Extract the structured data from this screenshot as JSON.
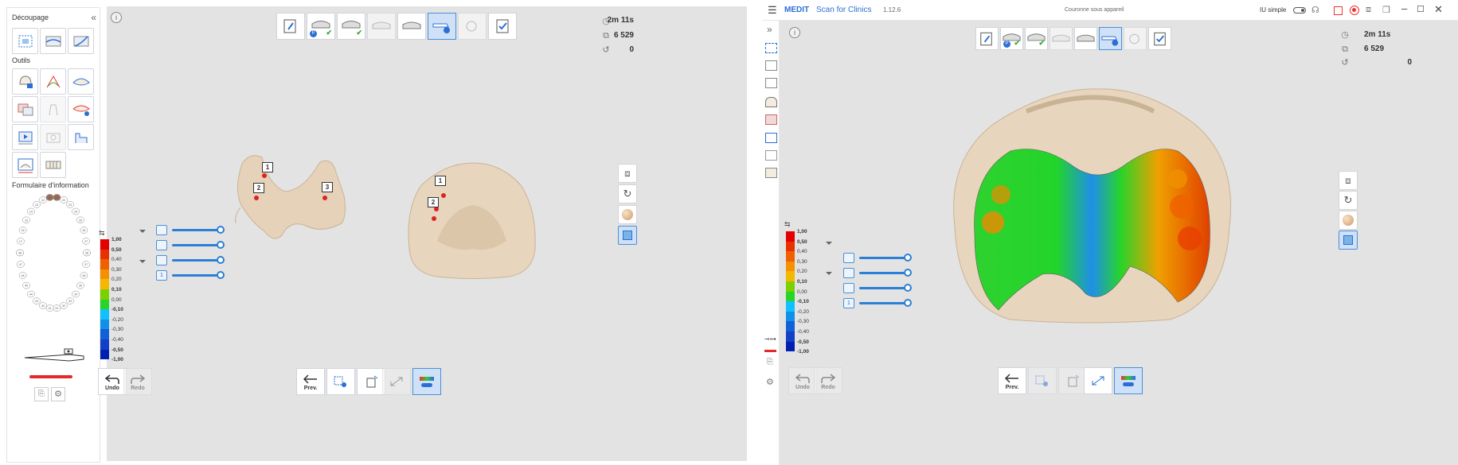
{
  "colors": {
    "accent": "#2b7fd6",
    "selected_bg": "#cfe1f7",
    "model": "#e8d5bd",
    "viewport_bg": "#e3e3e3"
  },
  "left_window": {
    "sidebar": {
      "section_cut": "Découpage",
      "section_tools": "Outils",
      "section_form": "Formulaire d'information",
      "cut_tools": [
        "crop-region-icon",
        "trim-surface-icon",
        "cut-curve-icon"
      ],
      "tools": [
        "lock-tooth-icon",
        "smooth-brush-icon",
        "arch-fill-icon",
        "compare-icon",
        "tooth-outline-icon",
        "align-arch-icon",
        "play-video-icon",
        "capture-icon",
        "profile-icon",
        "measure-icon",
        "tooth-library-icon"
      ],
      "tooth_numbers": [
        "11",
        "12",
        "13",
        "14",
        "15",
        "16",
        "17",
        "18",
        "21",
        "22",
        "23",
        "24",
        "25",
        "26",
        "27",
        "28",
        "31",
        "32",
        "33",
        "34",
        "35",
        "36",
        "37",
        "38",
        "41",
        "42",
        "43",
        "44",
        "45",
        "46",
        "47",
        "48"
      ]
    },
    "stats": {
      "time": "2m 11s",
      "shots": "6 529",
      "count": "0"
    },
    "steps": [
      "edit-step-icon",
      "upper-arch-step-icon",
      "lower-arch-step-icon",
      "occlusion-step-icon",
      "pre-op-step-icon",
      "analysis-step-icon",
      "review-step-icon",
      "complete-step-icon"
    ],
    "markers": [
      "1",
      "2",
      "3",
      "1",
      "2"
    ],
    "bottom": {
      "undo": "Undo",
      "redo": "Redo",
      "prev": "Prev."
    }
  },
  "right_window": {
    "titlebar": {
      "app": "MEDIT",
      "app_suffix": "Scan for Clinics",
      "version": "1.12.6",
      "case": "Couronne sous appareil",
      "mode": "IU simple"
    },
    "stats": {
      "time": "2m 11s",
      "shots": "6 529",
      "count": "0"
    },
    "bottom": {
      "undo": "Undo",
      "redo": "Redo",
      "prev": "Prev."
    }
  },
  "colorbar": {
    "ticks": [
      "1,00",
      "0,50",
      "0,40",
      "0,30",
      "0,20",
      "0,10",
      "0,00",
      "-0,10",
      "-0,20",
      "-0,30",
      "-0,40",
      "-0,50",
      "-1,00"
    ],
    "colors": [
      "#e40000",
      "#e83000",
      "#f06000",
      "#f59000",
      "#f5b800",
      "#7cd000",
      "#28d428",
      "#10c0ff",
      "#1090e8",
      "#1060d8",
      "#1040c8",
      "#0020b0"
    ]
  },
  "sliders": [
    {
      "icon": "upper-arch-icon",
      "value": 1.0
    },
    {
      "icon": "lower-arch-icon",
      "value": 1.0
    },
    {
      "icon": "target-icon",
      "value": 1.0
    },
    {
      "icon": "number-1-icon",
      "label": "1",
      "value": 1.0
    }
  ]
}
